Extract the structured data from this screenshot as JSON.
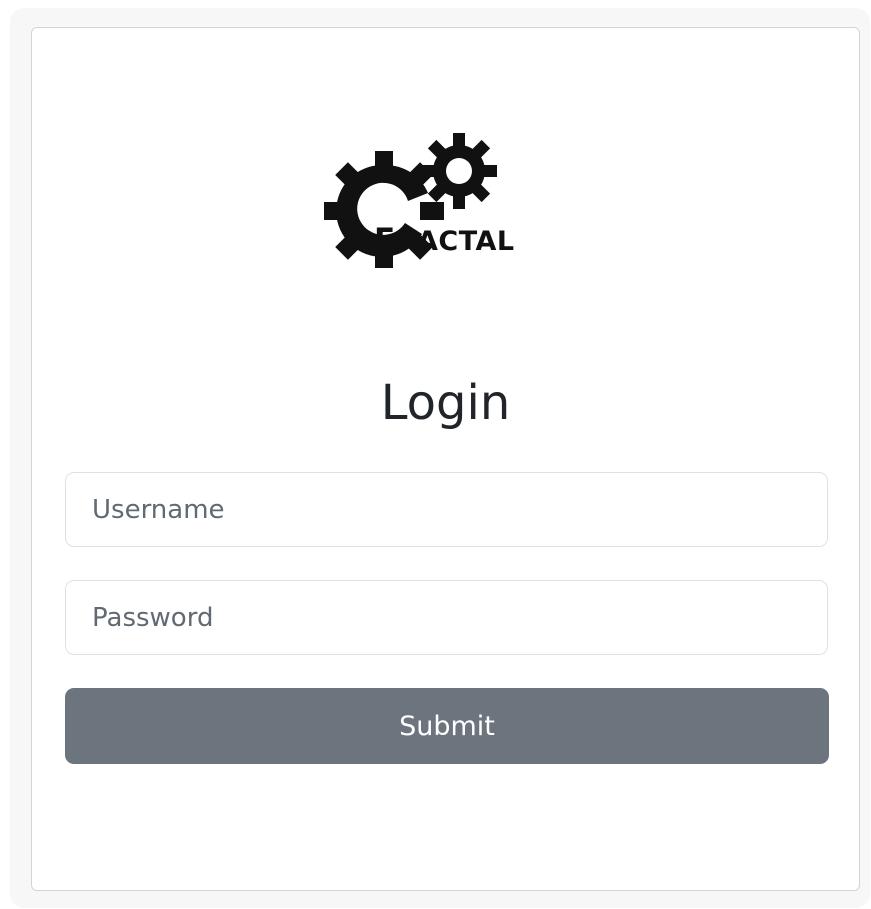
{
  "brand": {
    "logo_icon": "gears-icon",
    "name_first": "F",
    "name_rest": "RACTAL"
  },
  "login": {
    "title": "Login",
    "username_placeholder": "Username",
    "password_placeholder": "Password",
    "submit_label": "Submit"
  },
  "colors": {
    "submit_bg": "#6c757d",
    "text": "#212529",
    "border": "#dee2e6"
  }
}
